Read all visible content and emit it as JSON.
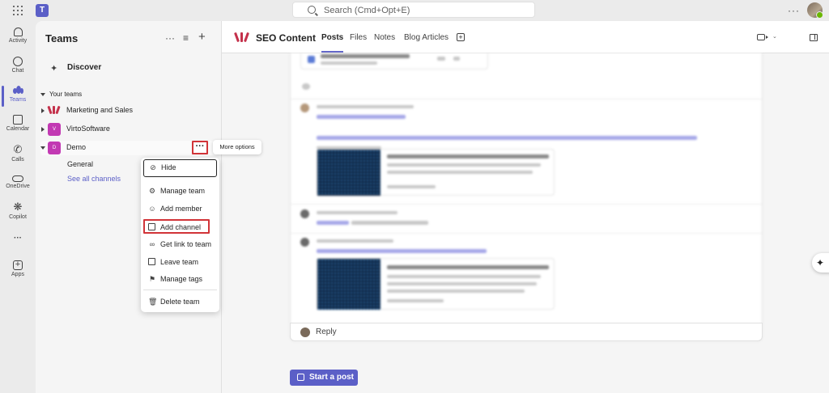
{
  "topbar": {
    "search_placeholder": "Search (Cmd+Opt+E)",
    "more": "···"
  },
  "rail": {
    "items": [
      {
        "label": "Activity",
        "icon": "bell-icon"
      },
      {
        "label": "Chat",
        "icon": "chat-icon"
      },
      {
        "label": "Teams",
        "icon": "teams-icon",
        "active": true
      },
      {
        "label": "Calendar",
        "icon": "calendar-icon"
      },
      {
        "label": "Calls",
        "icon": "phone-icon"
      },
      {
        "label": "OneDrive",
        "icon": "cloud-icon"
      },
      {
        "label": "Copilot",
        "icon": "copilot-icon"
      },
      {
        "label": "···",
        "icon": "more-icon"
      },
      {
        "label": "Apps",
        "icon": "apps-icon"
      }
    ]
  },
  "panel": {
    "title": "Teams",
    "discover": "Discover",
    "section_label": "Your teams",
    "teams": [
      {
        "name": "Marketing and Sales",
        "avatar": "",
        "color": "#c4314b"
      },
      {
        "name": "VirtoSoftware",
        "avatar": "V",
        "color": "#c239b3"
      },
      {
        "name": "Demo",
        "avatar": "D",
        "color": "#c239b3"
      }
    ],
    "channels": {
      "general": "General",
      "see_all": "See all channels"
    },
    "more_button": "···",
    "tooltip": "More options"
  },
  "menu": {
    "items": [
      {
        "label": "Hide",
        "icon": "hide-icon"
      },
      {
        "label": "Manage team",
        "icon": "gear-icon"
      },
      {
        "label": "Add member",
        "icon": "add-person-icon"
      },
      {
        "label": "Add channel",
        "icon": "add-channel-icon"
      },
      {
        "label": "Get link to team",
        "icon": "link-icon"
      },
      {
        "label": "Leave team",
        "icon": "leave-icon"
      },
      {
        "label": "Manage tags",
        "icon": "tag-icon"
      },
      {
        "label": "Delete team",
        "icon": "trash-icon"
      }
    ]
  },
  "channel": {
    "name": "SEO Content",
    "tabs": [
      "Posts",
      "Files",
      "Notes",
      "Blog Articles"
    ],
    "active_tab": "Posts",
    "reply": "Reply",
    "start_post": "Start a post"
  },
  "colors": {
    "brand": "#5b5fc7",
    "highlight": "#d13438",
    "accent_logo": "#c4314b"
  }
}
